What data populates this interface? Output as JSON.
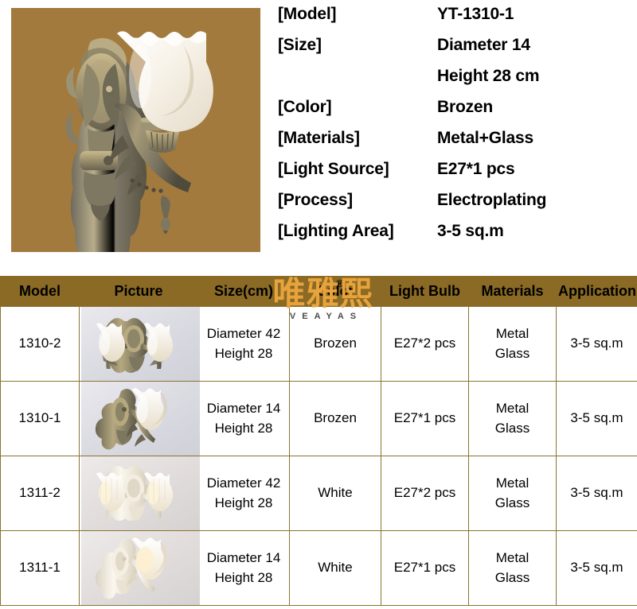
{
  "hero": {
    "photo_name": "wall-sconce-bronze-single-light",
    "background_color": "#a27a3e"
  },
  "spec_sheet": {
    "rows": [
      {
        "label": "[Model]",
        "value": "YT-1310-1"
      },
      {
        "label": "[Size]",
        "value": "Diameter 14"
      },
      {
        "label": "",
        "value": "Height 28 cm"
      },
      {
        "label": "[Color]",
        "value": "Brozen"
      },
      {
        "label": "[Materials]",
        "value": "Metal+Glass"
      },
      {
        "label": "[Light Source]",
        "value": "E27*1 pcs"
      },
      {
        "label": "[Process]",
        "value": "Electroplating"
      },
      {
        "label": "[Lighting Area]",
        "value": "3-5 sq.m"
      }
    ]
  },
  "watermark": {
    "cjk": "唯雅熙",
    "latin": "VEAYAS",
    "registered": "®",
    "color": "#e8a33c"
  },
  "table": {
    "header_color": "#8a6a24",
    "border_color": "#8a7330",
    "columns": [
      "Model",
      "Picture",
      "Size(cm)",
      "Color",
      "Light Bulb",
      "Materials",
      "Application"
    ],
    "rows": [
      {
        "model": "1310-2",
        "picture": "wall-sconce-bronze-double-light",
        "size_line1": "Diameter 42",
        "size_line2": "Height 28",
        "color": "Brozen",
        "bulb": "E27*2 pcs",
        "materials_line1": "Metal",
        "materials_line2": "Glass",
        "application": "3-5 sq.m"
      },
      {
        "model": "1310-1",
        "picture": "wall-sconce-bronze-single-light",
        "size_line1": "Diameter 14",
        "size_line2": "Height 28",
        "color": "Brozen",
        "bulb": "E27*1 pcs",
        "materials_line1": "Metal",
        "materials_line2": "Glass",
        "application": "3-5 sq.m"
      },
      {
        "model": "1311-2",
        "picture": "wall-sconce-white-double-light",
        "size_line1": "Diameter 42",
        "size_line2": "Height 28",
        "color": "White",
        "bulb": "E27*2 pcs",
        "materials_line1": "Metal",
        "materials_line2": "Glass",
        "application": "3-5 sq.m"
      },
      {
        "model": "1311-1",
        "picture": "wall-sconce-white-single-light",
        "size_line1": "Diameter 14",
        "size_line2": "Height 28",
        "color": "White",
        "bulb": "E27*1 pcs",
        "materials_line1": "Metal",
        "materials_line2": "Glass",
        "application": "3-5 sq.m"
      }
    ]
  }
}
